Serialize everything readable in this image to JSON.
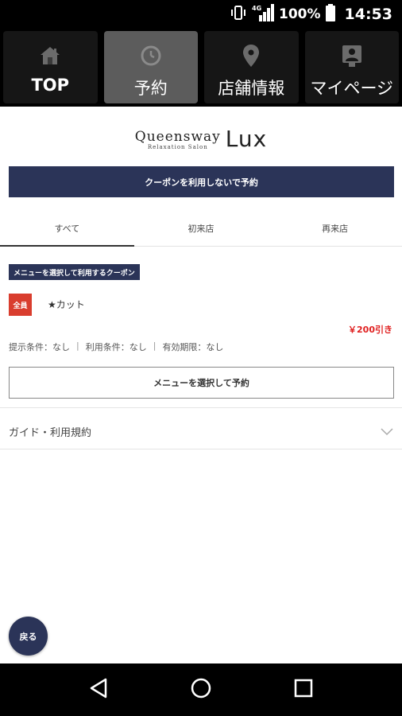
{
  "status_bar": {
    "battery": "100%",
    "time": "14:53",
    "network": "4G"
  },
  "nav": {
    "tabs": [
      {
        "label": "TOP",
        "icon": "home-icon"
      },
      {
        "label": "予約",
        "icon": "clock-icon"
      },
      {
        "label": "店舗情報",
        "icon": "map-pin-icon"
      },
      {
        "label": "マイページ",
        "icon": "profile-icon"
      }
    ],
    "active_index": 1
  },
  "logo": {
    "name": "Queensway",
    "subtitle": "Relaxation Salon",
    "suffix": "Lux"
  },
  "reserve_without_coupon": "クーポンを利用しないで予約",
  "filter_tabs": [
    "すべて",
    "初来店",
    "再来店"
  ],
  "coupon": {
    "badge": "メニューを選択して利用するクーポン",
    "tag": "全員",
    "name": "★カット",
    "price": "￥200引き",
    "conditions": {
      "display": "提示条件：なし",
      "usage": "利用条件：なし",
      "expiry": "有効期限：なし",
      "separator": "|"
    },
    "select_button": "メニューを選択して予約"
  },
  "guide": {
    "label": "ガイド・利用規約"
  },
  "back_button": "戻る",
  "colors": {
    "primary": "#2b3458",
    "accent_red": "#d93d2e",
    "price_red": "#e02020"
  }
}
